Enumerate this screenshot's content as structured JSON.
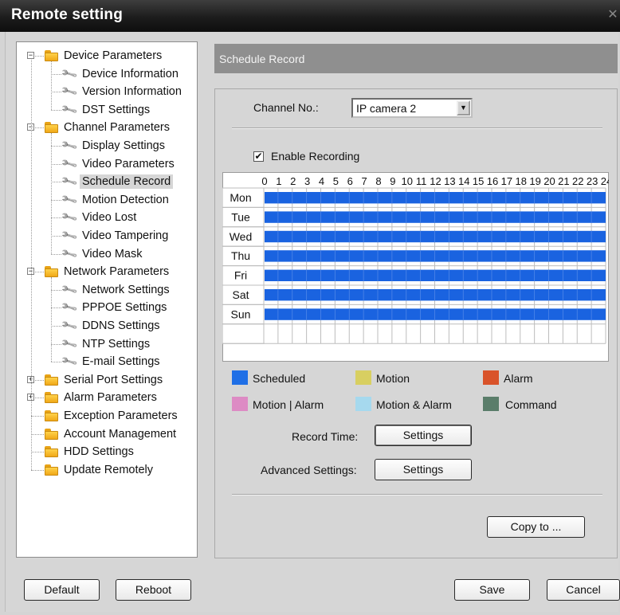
{
  "window": {
    "title": "Remote setting",
    "close_glyph": "✕"
  },
  "tree": {
    "items": [
      {
        "label": "Device Parameters",
        "type": "folder",
        "level": 0,
        "expander": "−"
      },
      {
        "label": "Device Information",
        "type": "leaf",
        "level": 1
      },
      {
        "label": "Version Information",
        "type": "leaf",
        "level": 1
      },
      {
        "label": "DST Settings",
        "type": "leaf",
        "level": 1
      },
      {
        "label": "Channel Parameters",
        "type": "folder",
        "level": 0,
        "expander": "−"
      },
      {
        "label": "Display Settings",
        "type": "leaf",
        "level": 1
      },
      {
        "label": "Video Parameters",
        "type": "leaf",
        "level": 1
      },
      {
        "label": "Schedule Record",
        "type": "leaf",
        "level": 1,
        "selected": true
      },
      {
        "label": "Motion Detection",
        "type": "leaf",
        "level": 1
      },
      {
        "label": "Video Lost",
        "type": "leaf",
        "level": 1
      },
      {
        "label": "Video Tampering",
        "type": "leaf",
        "level": 1
      },
      {
        "label": "Video Mask",
        "type": "leaf",
        "level": 1
      },
      {
        "label": "Network Parameters",
        "type": "folder",
        "level": 0,
        "expander": "−"
      },
      {
        "label": "Network Settings",
        "type": "leaf",
        "level": 1
      },
      {
        "label": "PPPOE Settings",
        "type": "leaf",
        "level": 1
      },
      {
        "label": "DDNS Settings",
        "type": "leaf",
        "level": 1
      },
      {
        "label": "NTP Settings",
        "type": "leaf",
        "level": 1
      },
      {
        "label": "E-mail Settings",
        "type": "leaf",
        "level": 1
      },
      {
        "label": "Serial Port Settings",
        "type": "folder",
        "level": 0,
        "expander": "+"
      },
      {
        "label": "Alarm Parameters",
        "type": "folder",
        "level": 0,
        "expander": "+"
      },
      {
        "label": "Exception Parameters",
        "type": "folder",
        "level": 0
      },
      {
        "label": "Account Management",
        "type": "folder",
        "level": 0
      },
      {
        "label": "HDD Settings",
        "type": "folder",
        "level": 0
      },
      {
        "label": "Update Remotely",
        "type": "folder",
        "level": 0
      }
    ]
  },
  "section_title": "Schedule Record",
  "channel": {
    "label": "Channel No.:",
    "value": "IP camera 2"
  },
  "enable_recording": {
    "label": "Enable Recording",
    "checked": true,
    "check_glyph": "✔"
  },
  "schedule": {
    "hours": [
      "0",
      "1",
      "2",
      "3",
      "4",
      "5",
      "6",
      "7",
      "8",
      "9",
      "10",
      "11",
      "12",
      "13",
      "14",
      "15",
      "16",
      "17",
      "18",
      "19",
      "20",
      "21",
      "22",
      "23",
      "24"
    ],
    "days": [
      "Mon",
      "Tue",
      "Wed",
      "Thu",
      "Fri",
      "Sat",
      "Sun"
    ],
    "scheduled_color": "#1a63e0",
    "coverage": "all day, every day"
  },
  "legend": [
    {
      "label": "Scheduled",
      "color": "#1f6fe6"
    },
    {
      "label": "Motion",
      "color": "#d8cf61"
    },
    {
      "label": "Alarm",
      "color": "#d9532a"
    },
    {
      "label": "Motion | Alarm",
      "color": "#dd8bc4"
    },
    {
      "label": "Motion & Alarm",
      "color": "#a6d9ee"
    },
    {
      "label": "Command",
      "color": "#5a7d6a"
    }
  ],
  "record_time": {
    "label": "Record Time:",
    "button": "Settings"
  },
  "advanced": {
    "label": "Advanced Settings:",
    "button": "Settings"
  },
  "copy_button": "Copy to ...",
  "footer": {
    "default": "Default",
    "reboot": "Reboot",
    "save": "Save",
    "cancel": "Cancel"
  }
}
